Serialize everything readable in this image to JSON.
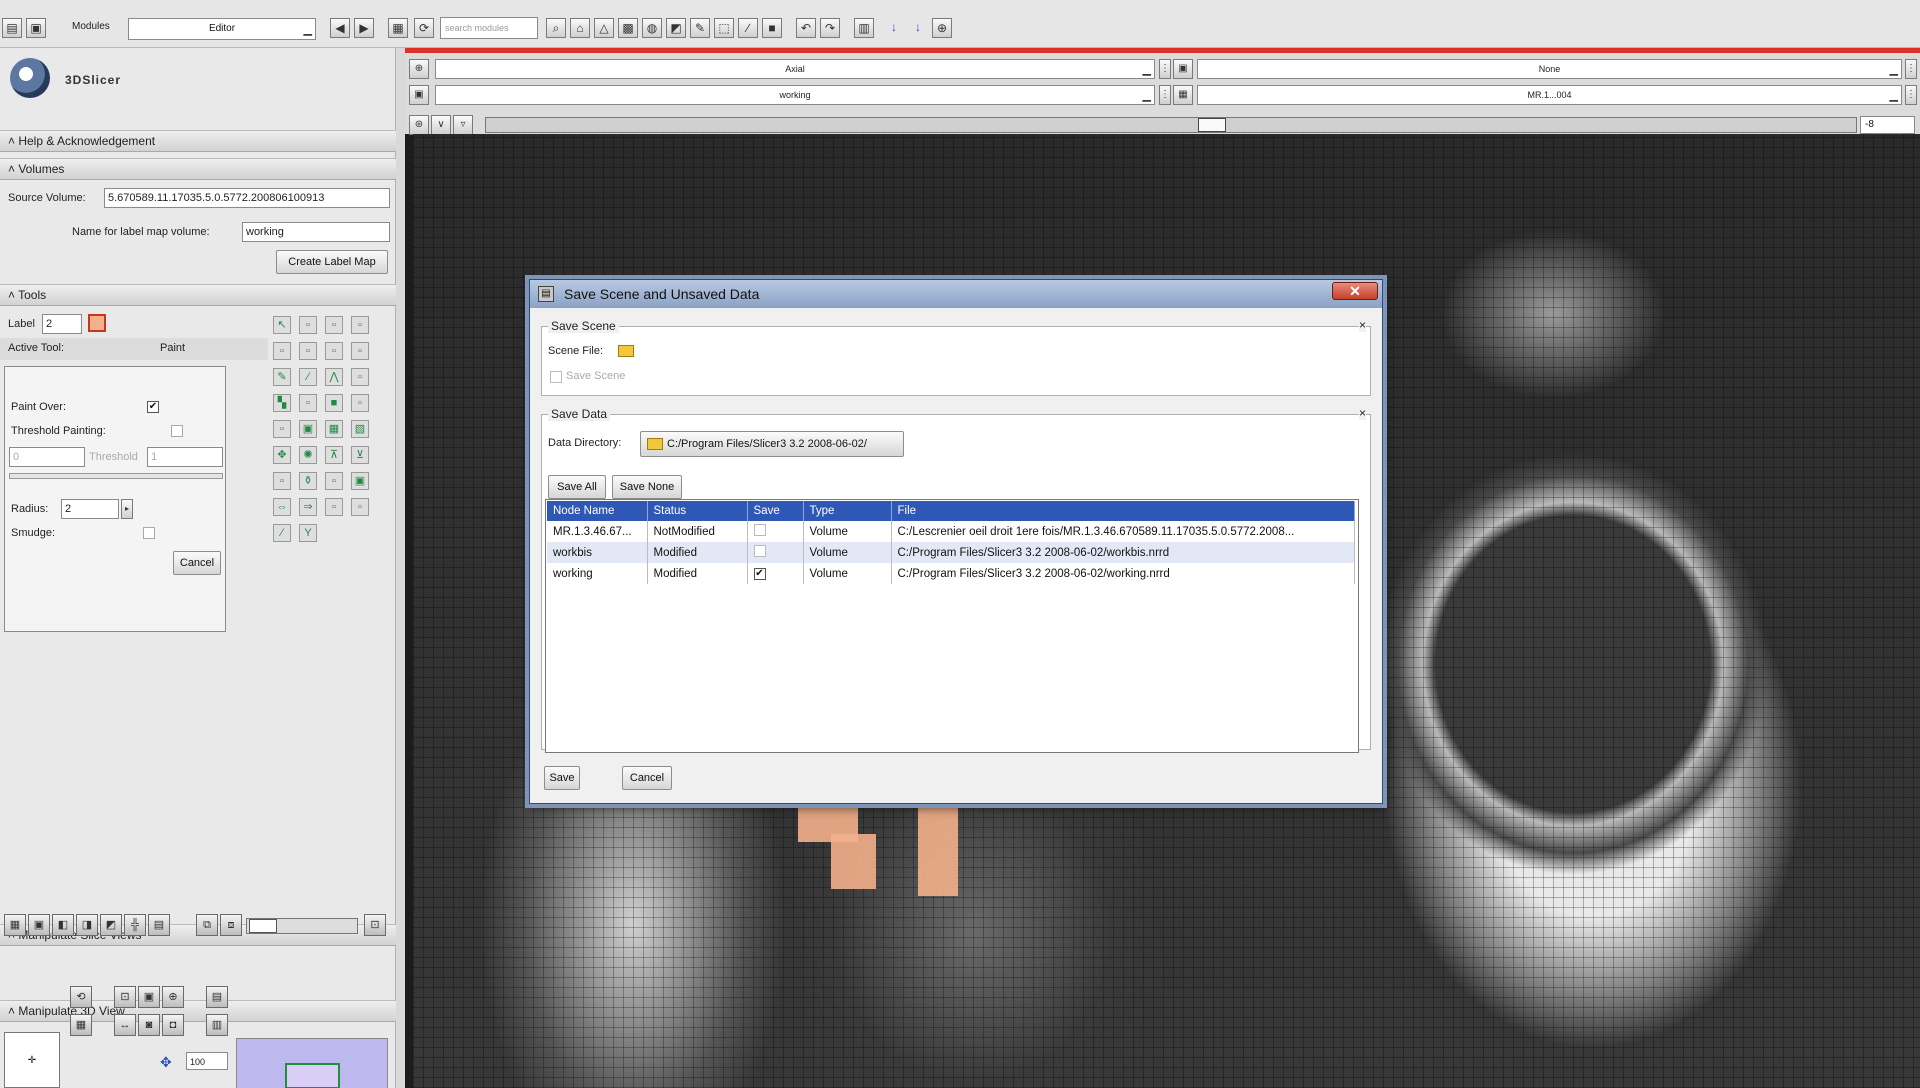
{
  "toolbar": {
    "modules_label": "Modules",
    "module_selected": "Editor",
    "search_placeholder": "search modules"
  },
  "app": {
    "logo_text": "3DSlicer"
  },
  "sections": {
    "help": "Help & Acknowledgement",
    "volumes": "Volumes",
    "tools": "Tools",
    "manipulate_slice": "Manipulate Slice Views",
    "manipulate_3d": "Manipulate 3D View"
  },
  "volumes": {
    "source_label": "Source Volume:",
    "source_value": "5.670589.11.17035.5.0.5772.200806100913",
    "name_label": "Name for label map volume:",
    "name_value": "working",
    "create_button": "Create Label Map"
  },
  "tools": {
    "label_label": "Label",
    "label_value": "2",
    "active_tool_label": "Active Tool:",
    "active_tool_value": "Paint",
    "paint_over": "Paint Over:",
    "threshold_painting": "Threshold Painting:",
    "threshold_min": "0",
    "threshold_label": "Threshold",
    "threshold_max": "1",
    "radius_label": "Radius:",
    "radius_value": "2",
    "smudge_label": "Smudge:",
    "cancel": "Cancel"
  },
  "view3d": {
    "zoom_value": "100"
  },
  "viewer": {
    "orientation": "Axial",
    "foreground": "None",
    "label_layer": "working",
    "background": "MR.1...004",
    "offset": "-8"
  },
  "dialog": {
    "title": "Save Scene and Unsaved Data",
    "save_scene_group": "Save Scene",
    "scene_file_label": "Scene File:",
    "save_scene_checkbox": "Save Scene",
    "save_data_group": "Save Data",
    "data_directory_label": "Data Directory:",
    "data_directory_value": "C:/Program Files/Slicer3 3.2 2008-06-02/",
    "save_all": "Save All",
    "save_none": "Save None",
    "columns": [
      "Node Name",
      "Status",
      "Save",
      "Type",
      "File"
    ],
    "rows": [
      {
        "name": "MR.1.3.46.67...",
        "status": "NotModified",
        "save": "",
        "type": "Volume",
        "file": "C:/Lescrenier oeil droit 1ere fois/MR.1.3.46.670589.11.17035.5.0.5772.2008..."
      },
      {
        "name": "workbis",
        "status": "Modified",
        "save": "",
        "type": "Volume",
        "file": "C:/Program Files/Slicer3 3.2 2008-06-02/workbis.nrrd"
      },
      {
        "name": "working",
        "status": "Modified",
        "save": "✔",
        "type": "Volume",
        "file": "C:/Program Files/Slicer3 3.2 2008-06-02/working.nrrd"
      }
    ],
    "save_button": "Save",
    "cancel_button": "Cancel",
    "close_glyph": "✕"
  },
  "colors": {
    "accent_red": "#e0302a",
    "table_header": "#2f57b5",
    "arrow": "#f6b800",
    "label_color": "#f4b08c"
  }
}
